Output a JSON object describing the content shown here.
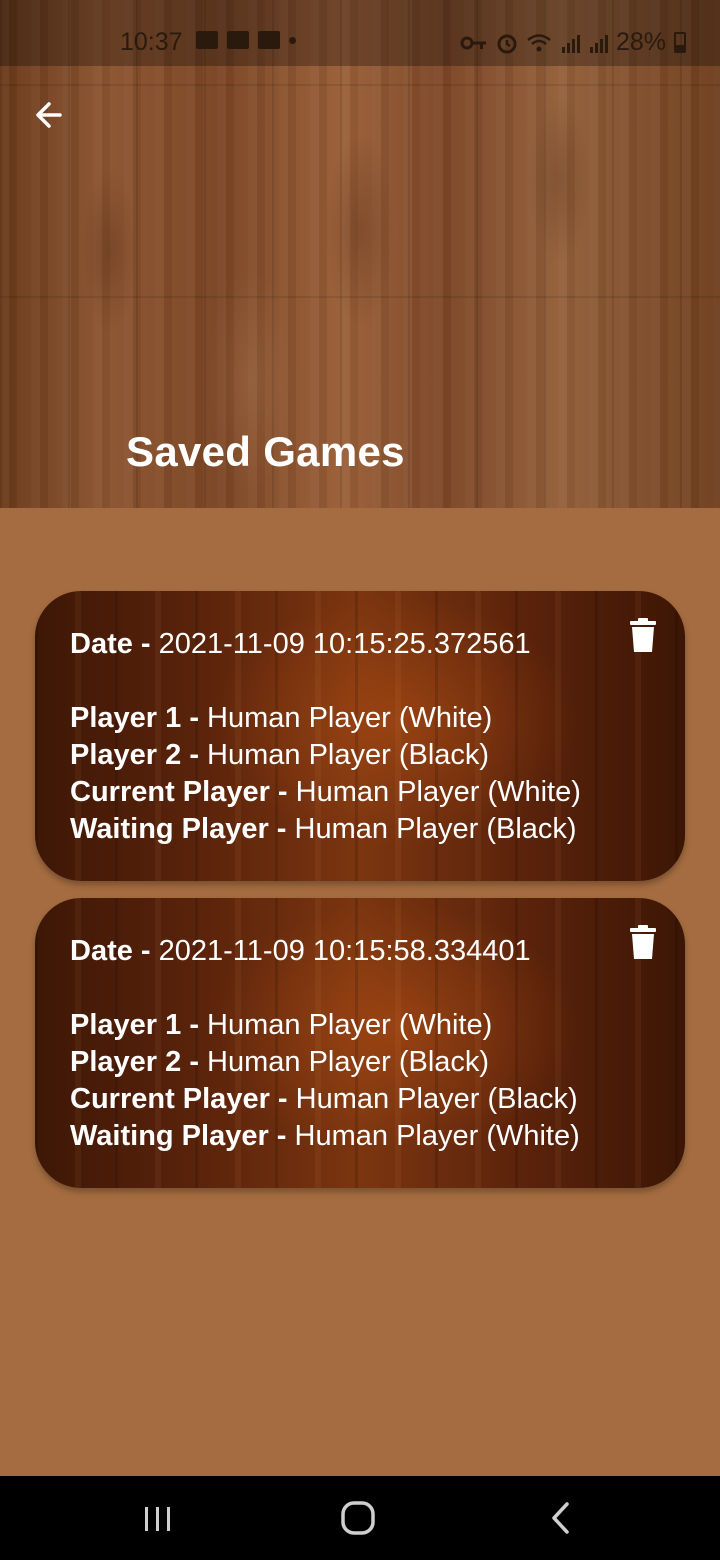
{
  "status_bar": {
    "time": "10:37",
    "battery": "28%",
    "left_icons": [
      "image-icon",
      "calendar-icon",
      "video-icon",
      "dot-icon"
    ],
    "right_icons": [
      "vpn-key-icon",
      "alarm-icon",
      "wifi-icon",
      "signal-icon",
      "signal-icon",
      "battery-icon"
    ]
  },
  "header": {
    "title": "Saved Games",
    "back_icon": "arrow-left-icon"
  },
  "colors": {
    "page_background": "#a46c40",
    "text": "#ffffff"
  },
  "saved_games": [
    {
      "date_label": "Date - ",
      "date_value": "2021-11-09 10:15:25.372561",
      "player1_label": "Player 1 - ",
      "player1_value": "Human Player (White)",
      "player2_label": "Player 2 - ",
      "player2_value": "Human Player (Black)",
      "current_label": "Current Player - ",
      "current_value": "Human Player (White)",
      "waiting_label": "Waiting Player - ",
      "waiting_value": "Human Player (Black)",
      "delete_icon": "trash-icon"
    },
    {
      "date_label": "Date - ",
      "date_value": "2021-11-09 10:15:58.334401",
      "player1_label": "Player 1 - ",
      "player1_value": "Human Player (White)",
      "player2_label": "Player 2 - ",
      "player2_value": "Human Player (Black)",
      "current_label": "Current Player - ",
      "current_value": "Human Player (Black)",
      "waiting_label": "Waiting Player - ",
      "waiting_value": "Human Player (White)",
      "delete_icon": "trash-icon"
    }
  ],
  "nav_bar": {
    "recents_icon": "recents-icon",
    "home_icon": "home-icon",
    "back_icon": "back-chevron-icon"
  }
}
